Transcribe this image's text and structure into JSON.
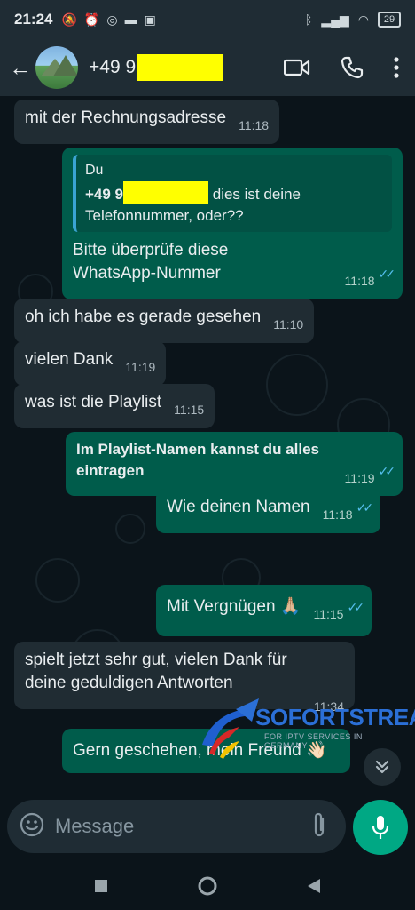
{
  "status_bar": {
    "time": "21:24",
    "battery": "29"
  },
  "header": {
    "contact_prefix": "+49 9"
  },
  "messages": [
    {
      "dir": "in",
      "text": "mit der Rechnungsadresse",
      "time": "11:18"
    },
    {
      "dir": "out",
      "quote_author": "Du",
      "quote_prefix": "+49 9",
      "quote_suffix": "dies ist deine",
      "quote_line2": "Telefonnummer, oder??",
      "text_line1": "Bitte überprüfe diese",
      "text_line2": "WhatsApp-Nummer",
      "time": "11:18",
      "status": "read"
    },
    {
      "dir": "in",
      "text": "oh ich habe es gerade gesehen",
      "time": "11:10"
    },
    {
      "dir": "in",
      "text": "vielen Dank",
      "time": "11:19"
    },
    {
      "dir": "in",
      "text": "was ist die Playlist",
      "time": "11:15"
    },
    {
      "dir": "out",
      "text_line1": "Im Playlist-Namen kannst du alles",
      "text_line2": "eintragen",
      "time": "11:19",
      "status": "read"
    },
    {
      "dir": "out",
      "text": "Wie deinen Namen",
      "time": "11:18",
      "status": "read"
    },
    {
      "dir": "out",
      "text": "Mit Vergnügen 🙏🏼",
      "time": "11:15",
      "status": "read"
    },
    {
      "dir": "in",
      "text_line1": "spielt jetzt sehr gut, vielen Dank für",
      "text_line2": "deine geduldigen Antworten",
      "time": "11:34"
    },
    {
      "dir": "out",
      "text": "Gern geschehen, mein Freund 👋🏻",
      "time": ""
    }
  ],
  "watermark": {
    "brand": "SOFORTSTREAM",
    "tagline": "FOR IPTV SERVICES IN GERMANY"
  },
  "composer": {
    "placeholder": "Message"
  },
  "colors": {
    "outgoing": "#005c4b",
    "incoming": "#202c33",
    "accent": "#00a884",
    "read_ticks": "#53bdeb",
    "redaction": "#ffff00"
  },
  "icons": [
    "back-arrow-icon",
    "video-call-icon",
    "phone-icon",
    "more-options-icon",
    "emoji-icon",
    "attach-icon",
    "camera-icon",
    "mic-icon",
    "chevron-down-icon"
  ]
}
